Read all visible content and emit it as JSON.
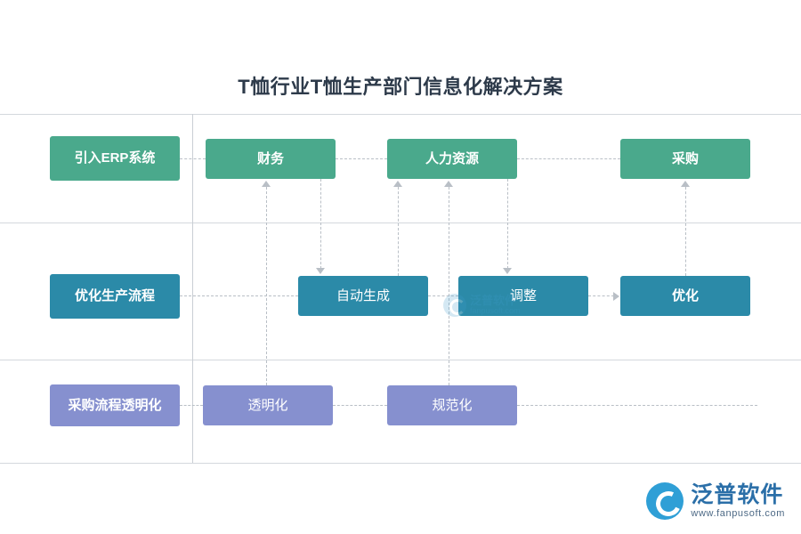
{
  "title": "T恤行业T恤生产部门信息化解决方案",
  "rows": [
    {
      "label": "引入ERP系统",
      "color": "#4aa98c",
      "nodes": [
        {
          "label": "财务",
          "color": "#4aa98c"
        },
        {
          "label": "人力资源",
          "color": "#4aa98c"
        },
        {
          "label": "采购",
          "color": "#4aa98c"
        }
      ]
    },
    {
      "label": "优化生产流程",
      "color": "#2b8aa8",
      "nodes": [
        {
          "label": "自动生成",
          "color": "#2b8aa8"
        },
        {
          "label": "调整",
          "color": "#2b8aa8"
        },
        {
          "label": "优化",
          "color": "#2b8aa8"
        }
      ]
    },
    {
      "label": "采购流程透明化",
      "color": "#8690cf",
      "nodes": [
        {
          "label": "透明化",
          "color": "#8690cf"
        },
        {
          "label": "规范化",
          "color": "#8690cf"
        }
      ]
    }
  ],
  "watermark": {
    "text_line1": "泛普软件",
    "text_line2": "fanpusoft.com"
  },
  "logo": {
    "name": "泛普软件",
    "url": "www.fanpusoft.com"
  }
}
